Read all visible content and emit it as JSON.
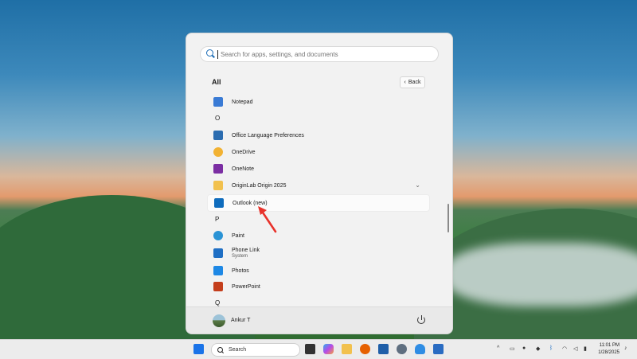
{
  "search": {
    "placeholder": "Search for apps, settings, and documents",
    "value": ""
  },
  "section_title": "All",
  "back_label": "Back",
  "apps": [
    {
      "type": "app",
      "label": "Notepad",
      "icon": "notepad-icon",
      "color": "#3a7bd5"
    },
    {
      "type": "letter",
      "label": "O"
    },
    {
      "type": "app",
      "label": "Office Language Preferences",
      "icon": "office-language-icon",
      "color": "#2b6cb0"
    },
    {
      "type": "app",
      "label": "OneDrive",
      "icon": "onedrive-icon",
      "color": "#f2b233"
    },
    {
      "type": "app",
      "label": "OneNote",
      "icon": "onenote-icon",
      "color": "#7b2ea3"
    },
    {
      "type": "folder",
      "label": "OriginLab Origin 2025",
      "icon": "folder-icon",
      "color": "#f2c14e"
    },
    {
      "type": "app",
      "label": "Outlook (new)",
      "icon": "outlook-icon",
      "color": "#0f6cbd",
      "highlighted": true
    },
    {
      "type": "letter",
      "label": "P"
    },
    {
      "type": "app",
      "label": "Paint",
      "icon": "paint-icon",
      "color": "#2a93d5"
    },
    {
      "type": "app",
      "label": "Phone Link",
      "sub": "System",
      "icon": "phone-link-icon",
      "color": "#1f6fc4"
    },
    {
      "type": "app",
      "label": "Photos",
      "icon": "photos-icon",
      "color": "#1e88e5"
    },
    {
      "type": "app",
      "label": "PowerPoint",
      "icon": "powerpoint-icon",
      "color": "#c43e1c"
    },
    {
      "type": "letter",
      "label": "Q"
    }
  ],
  "user": {
    "name": "Ankur T"
  },
  "taskbar": {
    "search_label": "Search",
    "time": "11:01 PM",
    "date": "1/28/2025"
  },
  "colors": {
    "accent": "#0f6cbd",
    "arrow": "#e8322b"
  }
}
